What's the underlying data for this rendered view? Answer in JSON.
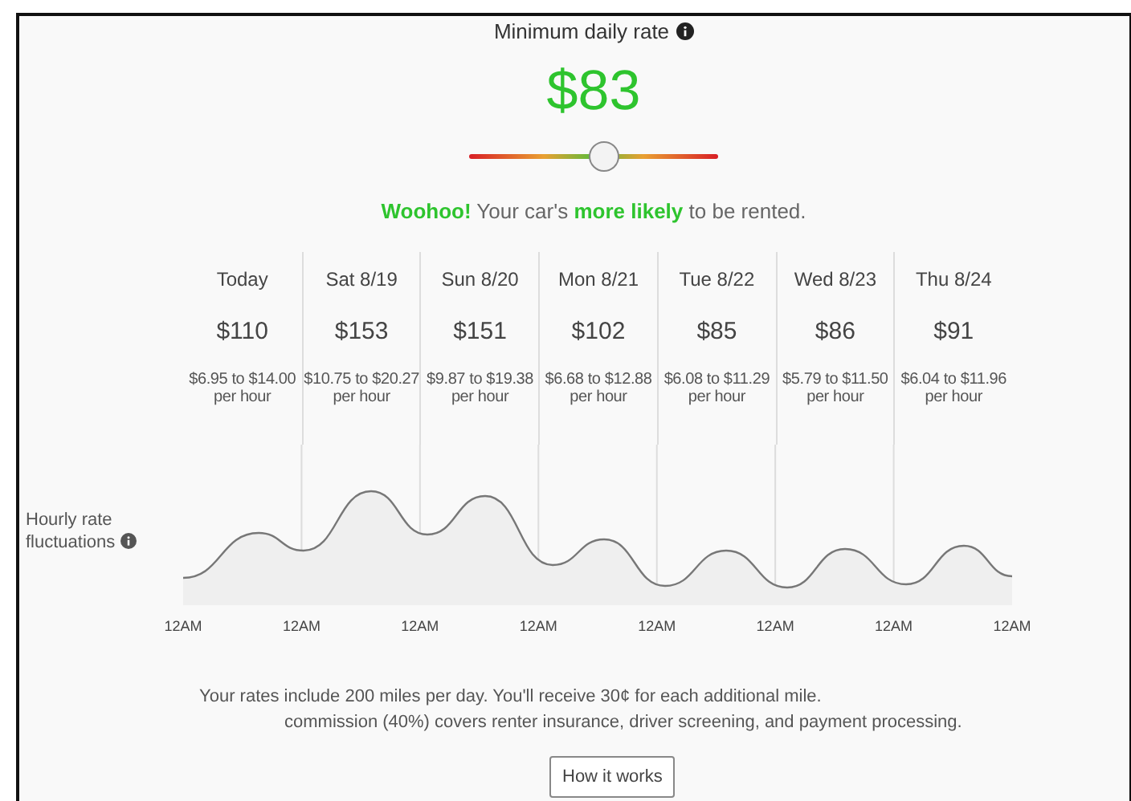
{
  "rate": {
    "title": "Minimum daily rate",
    "price": "$83",
    "slider": {
      "level": 0.54
    },
    "message": "**Woohoo!** Your car's **more likely** to be rented."
  },
  "days": [
    {
      "label": "Today",
      "price": "$110",
      "range": "$6.95 to $14.00",
      "unit": "per hour"
    },
    {
      "label": "Sat 8/19",
      "price": "$153",
      "range": "$10.75 to $20.27",
      "unit": "per hour"
    },
    {
      "label": "Sun 8/20",
      "price": "$151",
      "range": "$9.87 to $19.38",
      "unit": "per hour"
    },
    {
      "label": "Mon 8/21",
      "price": "$102",
      "range": "$6.68 to $12.88",
      "unit": "per hour"
    },
    {
      "label": "Tue 8/22",
      "price": "$85",
      "range": "$6.08 to $11.29",
      "unit": "per hour"
    },
    {
      "label": "Wed 8/23",
      "price": "$86",
      "range": "$5.79 to $11.50",
      "unit": "per hour"
    },
    {
      "label": "Thu 8/24",
      "price": "$91",
      "range": "$6.04 to $11.96",
      "unit": "per hour"
    }
  ],
  "fluctuations": {
    "label": "Hourly rate fluctuations",
    "axis_labels": [
      "12AM",
      "12AM",
      "12AM",
      "12AM",
      "12AM",
      "12AM",
      "12AM",
      "12AM"
    ]
  },
  "notes": [
    "Your rates include 200 miles per day. You'll receive 30¢ for each additional mile.",
    "commission (40%) covers renter insurance, driver screening, and payment processing."
  ],
  "button": "How it works"
}
